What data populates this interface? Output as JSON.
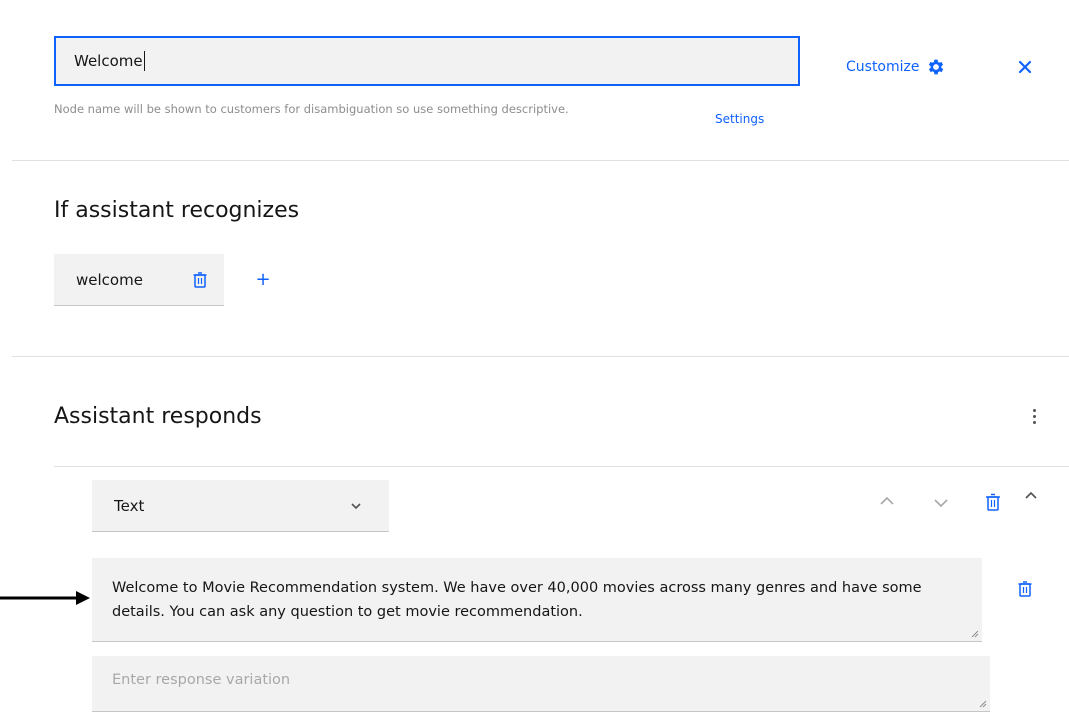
{
  "header": {
    "node_name_value": "Welcome",
    "helper_text": "Node name will be shown to customers for disambiguation so use something descriptive.",
    "settings_label": "Settings",
    "customize_label": "Customize",
    "icons": {
      "customize": "gear-icon",
      "close": "close-icon"
    }
  },
  "recognizes": {
    "title": "If assistant recognizes",
    "conditions": [
      {
        "label": "welcome"
      }
    ],
    "icons": {
      "remove": "trash-icon",
      "add": "plus-icon"
    }
  },
  "responds": {
    "title": "Assistant responds",
    "response_type": "Text",
    "responses": [
      {
        "value": "Welcome to Movie Recommendation system.  We have over 40,000 movies across many genres and have some details.  You can ask any question to get movie recommendation."
      }
    ],
    "variation_placeholder": "Enter response variation",
    "icons": {
      "menu": "overflow-menu-icon",
      "move_up": "chevron-up-icon",
      "move_down": "chevron-down-icon",
      "delete": "trash-icon",
      "collapse": "caret-up-icon"
    }
  },
  "colors": {
    "accent": "#0f62fe",
    "field_bg": "#f2f2f2",
    "text": "#161616",
    "helper": "#8d8d8d",
    "divider": "#e0e0e0"
  }
}
